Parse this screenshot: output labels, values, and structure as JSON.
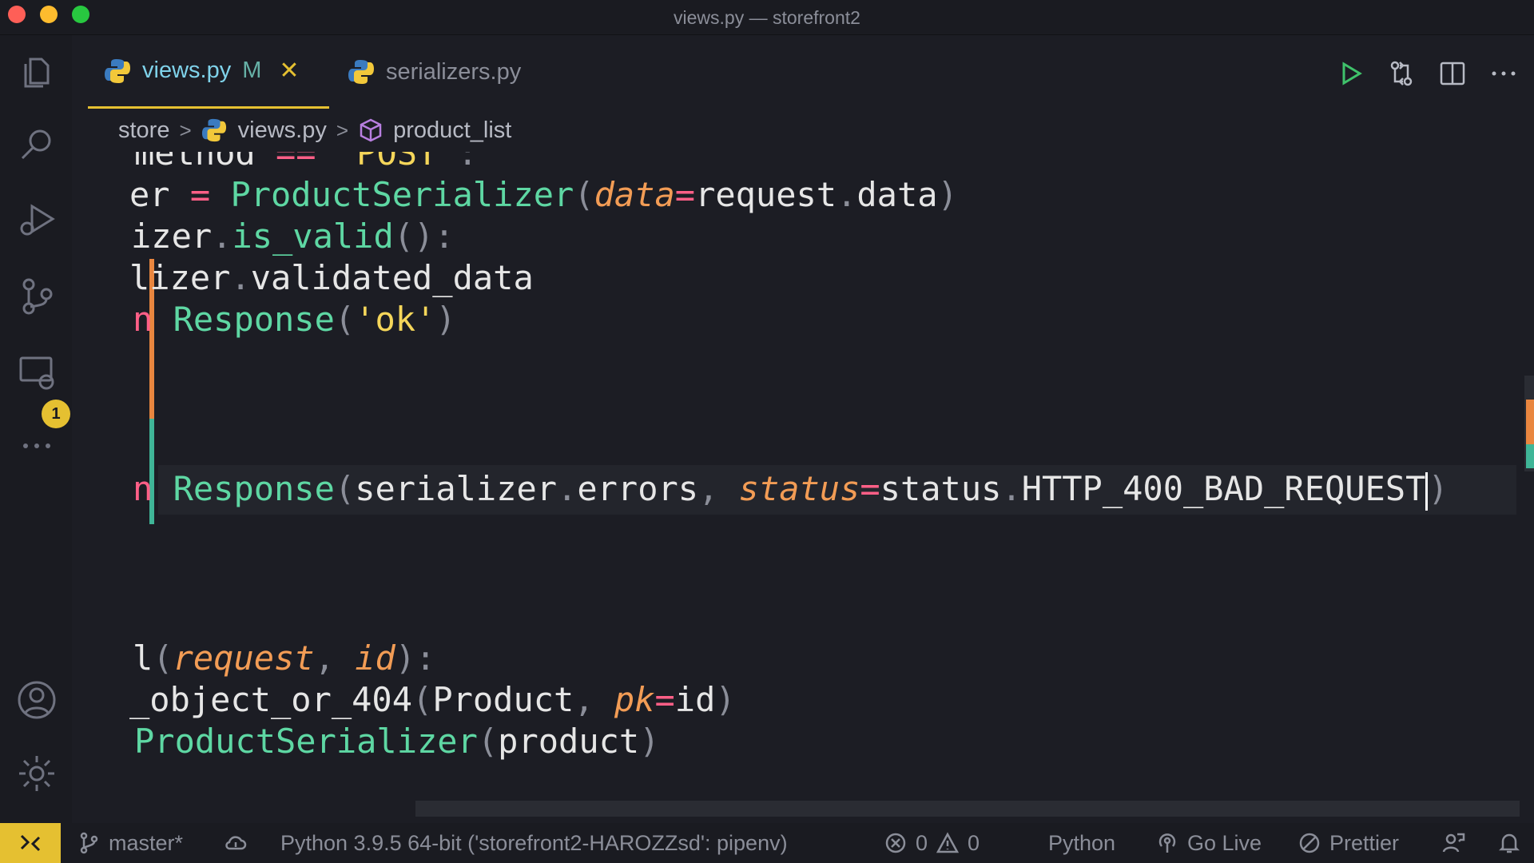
{
  "window": {
    "title": "views.py — storefront2"
  },
  "activity_bar": {
    "scm_badge": "1"
  },
  "tabs": [
    {
      "label": "views.py",
      "modified_marker": "M",
      "close": "✕",
      "active": true
    },
    {
      "label": "serializers.py",
      "active": false
    }
  ],
  "breadcrumb": {
    "folder": "store",
    "file": "views.py",
    "symbol": "product_list"
  },
  "code_lines": [
    [
      "method",
      " == ",
      "'POST'",
      ":"
    ],
    [
      "er",
      " = ",
      "ProductSerializer",
      "(",
      "data",
      "=",
      "request",
      ".",
      "data",
      ")"
    ],
    [
      "izer",
      ".",
      "is_valid",
      "():"
    ],
    [
      "lizer",
      ".",
      "validated_data"
    ],
    [
      "n",
      " ",
      "Response",
      "(",
      "'ok'",
      ")"
    ],
    [],
    [
      "n",
      " ",
      "Response",
      "(",
      "serializer",
      ".",
      "errors",
      ", ",
      "status",
      "=",
      "status",
      ".",
      "HTTP_400_BAD_REQUEST",
      ")"
    ],
    [],
    [],
    [],
    [
      "l",
      "(",
      "request",
      ", ",
      "id",
      "):"
    ],
    [
      "_object_or_404",
      "(",
      "Product",
      ", ",
      "pk",
      "=",
      "id",
      ")"
    ],
    [
      "ProductSerializer",
      "(",
      "product",
      ")"
    ]
  ],
  "status_bar": {
    "branch": "master*",
    "interpreter": "Python 3.9.5 64-bit ('storefront2-HAROZZsd': pipenv)",
    "errors": "0",
    "warnings": "0",
    "language": "Python",
    "go_live": "Go Live",
    "prettier": "Prettier"
  },
  "colors": {
    "accent": "#e5c031",
    "keyword": "#ff5f87",
    "function": "#5ed7a3",
    "string": "#f5d65a",
    "param": "#f29c55"
  }
}
